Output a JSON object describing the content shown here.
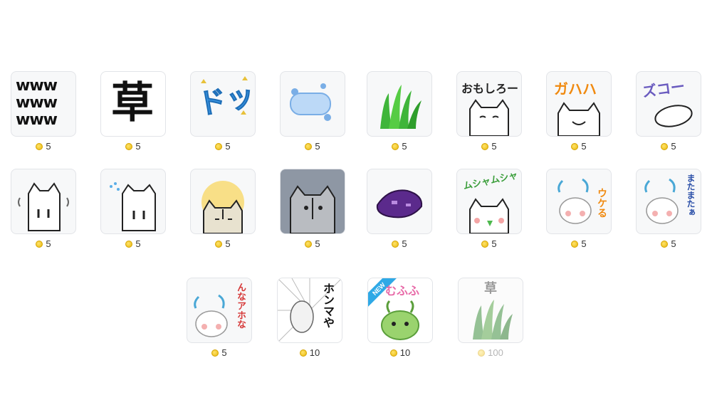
{
  "coin_icon": "coin-icon",
  "stickers": [
    {
      "id": "s1",
      "price": "5",
      "text": "www\nwww\nwww"
    },
    {
      "id": "s2",
      "price": "5",
      "text": "草"
    },
    {
      "id": "s3",
      "price": "5",
      "text": "ドッ"
    },
    {
      "id": "s4",
      "price": "5",
      "text": ""
    },
    {
      "id": "s5",
      "price": "5",
      "text": ""
    },
    {
      "id": "s6",
      "price": "5",
      "text": "おもしろー"
    },
    {
      "id": "s7",
      "price": "5",
      "text": "ガハハ"
    },
    {
      "id": "s8",
      "price": "5",
      "text": "ズコー"
    },
    {
      "id": "s9",
      "price": "5",
      "text": ""
    },
    {
      "id": "s10",
      "price": "5",
      "text": ""
    },
    {
      "id": "s11",
      "price": "5",
      "text": ""
    },
    {
      "id": "s12",
      "price": "5",
      "text": ""
    },
    {
      "id": "s13",
      "price": "5",
      "text": ""
    },
    {
      "id": "s14",
      "price": "5",
      "text": "ムシャムシャ"
    },
    {
      "id": "s15",
      "price": "5",
      "text": "ウケる"
    },
    {
      "id": "s16",
      "price": "5",
      "text": "またまたぁ"
    },
    {
      "id": "s17",
      "price": "5",
      "text": "んなアホな"
    },
    {
      "id": "s18",
      "price": "10",
      "text": "ホンマや"
    },
    {
      "id": "s19",
      "price": "10",
      "text": "むふふ",
      "badge": "NEW"
    },
    {
      "id": "s20",
      "price": "100",
      "text": "草"
    }
  ]
}
